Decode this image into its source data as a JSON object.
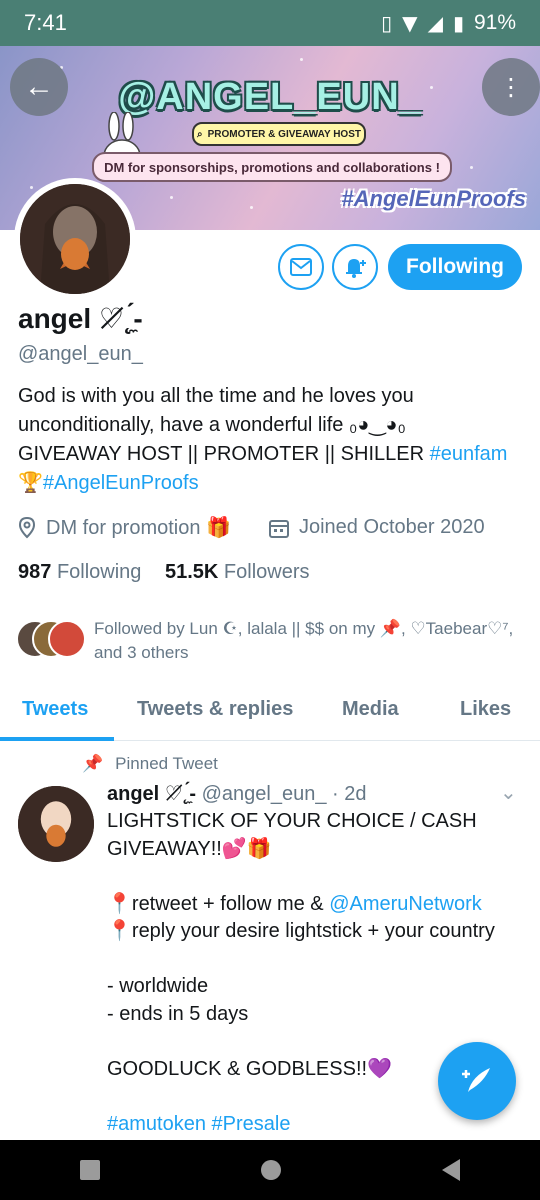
{
  "status": {
    "time": "7:41",
    "battery": "91%"
  },
  "banner": {
    "title": "@ANGEL_EUN_",
    "tag_label": "PROMOTER & GIVEAWAY HOST",
    "dm_text": "DM for sponsorships, promotions and collaborations !",
    "hashtag": "#AngelEunProofs"
  },
  "profile": {
    "follow_label": "Following",
    "name": "angel ♡̸˛̼́-",
    "handle": "@angel_eun_",
    "bio_line1": "God is with you all the time and he loves you unconditionally, have a wonderful life ₀◕‿◕₀",
    "bio_line2_prefix": "GIVEAWAY HOST || PROMOTER || SHILLER ",
    "bio_hashtag1": "#eunfam",
    "bio_trophy": "🏆",
    "bio_hashtag2": "#AngelEunProofs",
    "location": "DM for promotion 🎁",
    "joined": "Joined October 2020",
    "following_count": "987",
    "following_label": "Following",
    "followers_count": "51.5K",
    "followers_label": "Followers",
    "followed_by": "Followed by Lun ☪, lalala || $$ on my 📌, ♡Taebear♡⁷, and 3 others"
  },
  "tabs": [
    "Tweets",
    "Tweets & replies",
    "Media",
    "Likes"
  ],
  "tweet": {
    "pinned_label": "Pinned Tweet",
    "author_name": "angel ♡̸˛̼́-",
    "author_handle": "@angel_eun_",
    "time": "· 2d",
    "line1": "LIGHTSTICK OF YOUR CHOICE / CASH GIVEAWAY!!💕🎁",
    "line2_prefix": "📍retweet + follow me & ",
    "line2_mention": "@AmeruNetwork",
    "line3": "📍reply your desire lightstick + your country",
    "line4": "- worldwide",
    "line5": "- ends in 5 days",
    "line6": "GOODLUCK & GODBLESS!!💜",
    "tag1": "#amutoken",
    "tag2": "#Presale"
  },
  "colors": {
    "accent": "#1da1f2",
    "statusbar": "#4a7f74"
  }
}
